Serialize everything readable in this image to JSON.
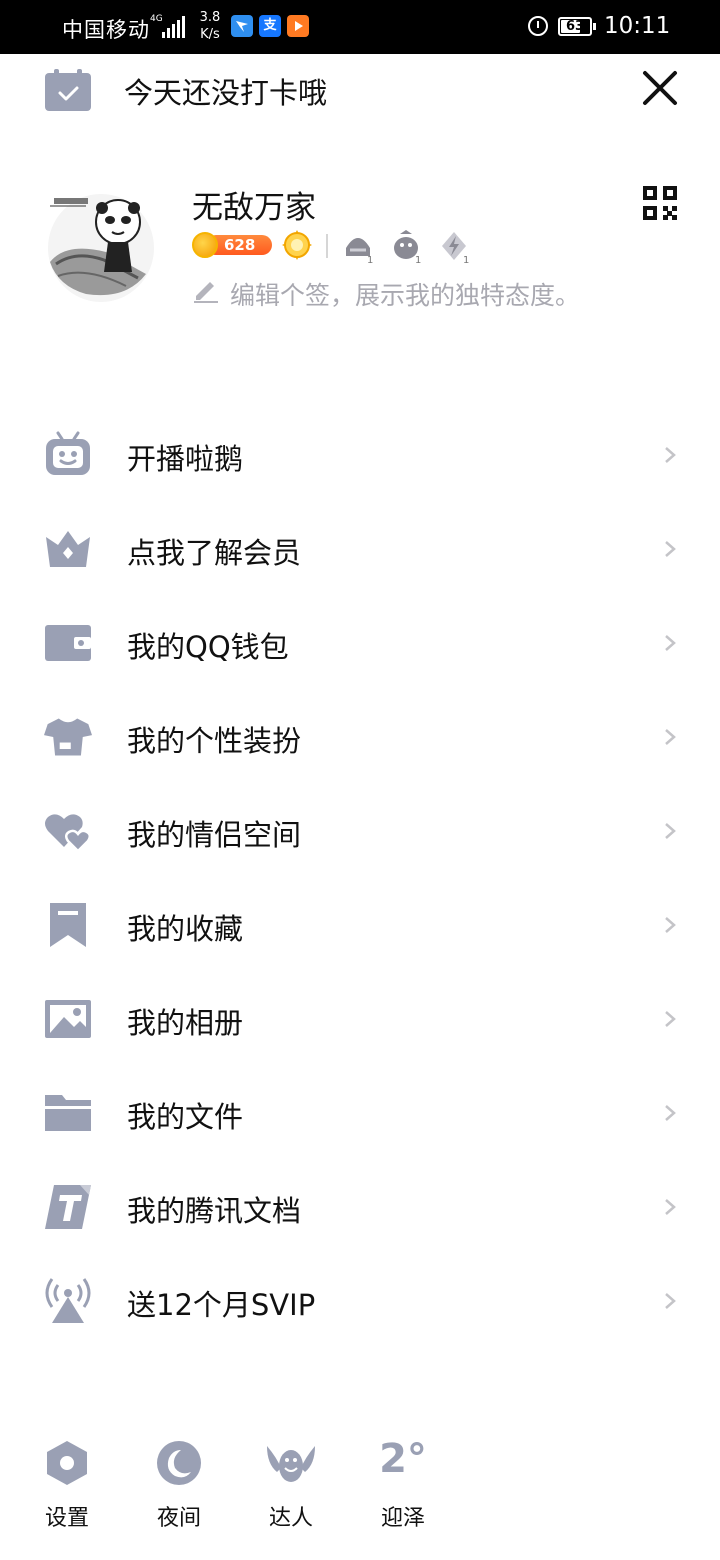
{
  "status_bar": {
    "carrier": "中国移动",
    "network": "4G",
    "speed_value": "3.8",
    "speed_unit": "K/s",
    "apps": [
      "bird-app-icon",
      "alipay-icon",
      "video-app-icon"
    ],
    "alipay_glyph": "支",
    "battery": "63",
    "time": "10:11"
  },
  "checkin": {
    "text": "今天还没打卡哦"
  },
  "profile": {
    "nickname": "无敌万家",
    "coin_count": "628",
    "signature_placeholder": "编辑个签，展示我的独特态度。"
  },
  "menu": {
    "items": [
      {
        "label": "开播啦鹅",
        "icon": "tv-robot-icon"
      },
      {
        "label": "点我了解会员",
        "icon": "crown-icon"
      },
      {
        "label": "我的QQ钱包",
        "icon": "wallet-icon"
      },
      {
        "label": "我的个性装扮",
        "icon": "tshirt-icon"
      },
      {
        "label": "我的情侣空间",
        "icon": "hearts-icon"
      },
      {
        "label": "我的收藏",
        "icon": "bookmark-icon"
      },
      {
        "label": "我的相册",
        "icon": "photo-icon"
      },
      {
        "label": "我的文件",
        "icon": "folder-icon"
      },
      {
        "label": "我的腾讯文档",
        "icon": "tencent-docs-icon"
      },
      {
        "label": "送12个月SVIP",
        "icon": "broadcast-icon"
      }
    ]
  },
  "bottom_bar": {
    "settings_label": "设置",
    "night_label": "夜间",
    "expert_label": "达人",
    "weather_label": "迎泽",
    "temperature": "2°"
  },
  "colors": {
    "icon_gray": "#9aa0b4",
    "chevron": "#c4c4c8",
    "coin_orange": "#ff5a1f",
    "text_dark": "#111111",
    "text_hint": "#a8a8b0"
  }
}
